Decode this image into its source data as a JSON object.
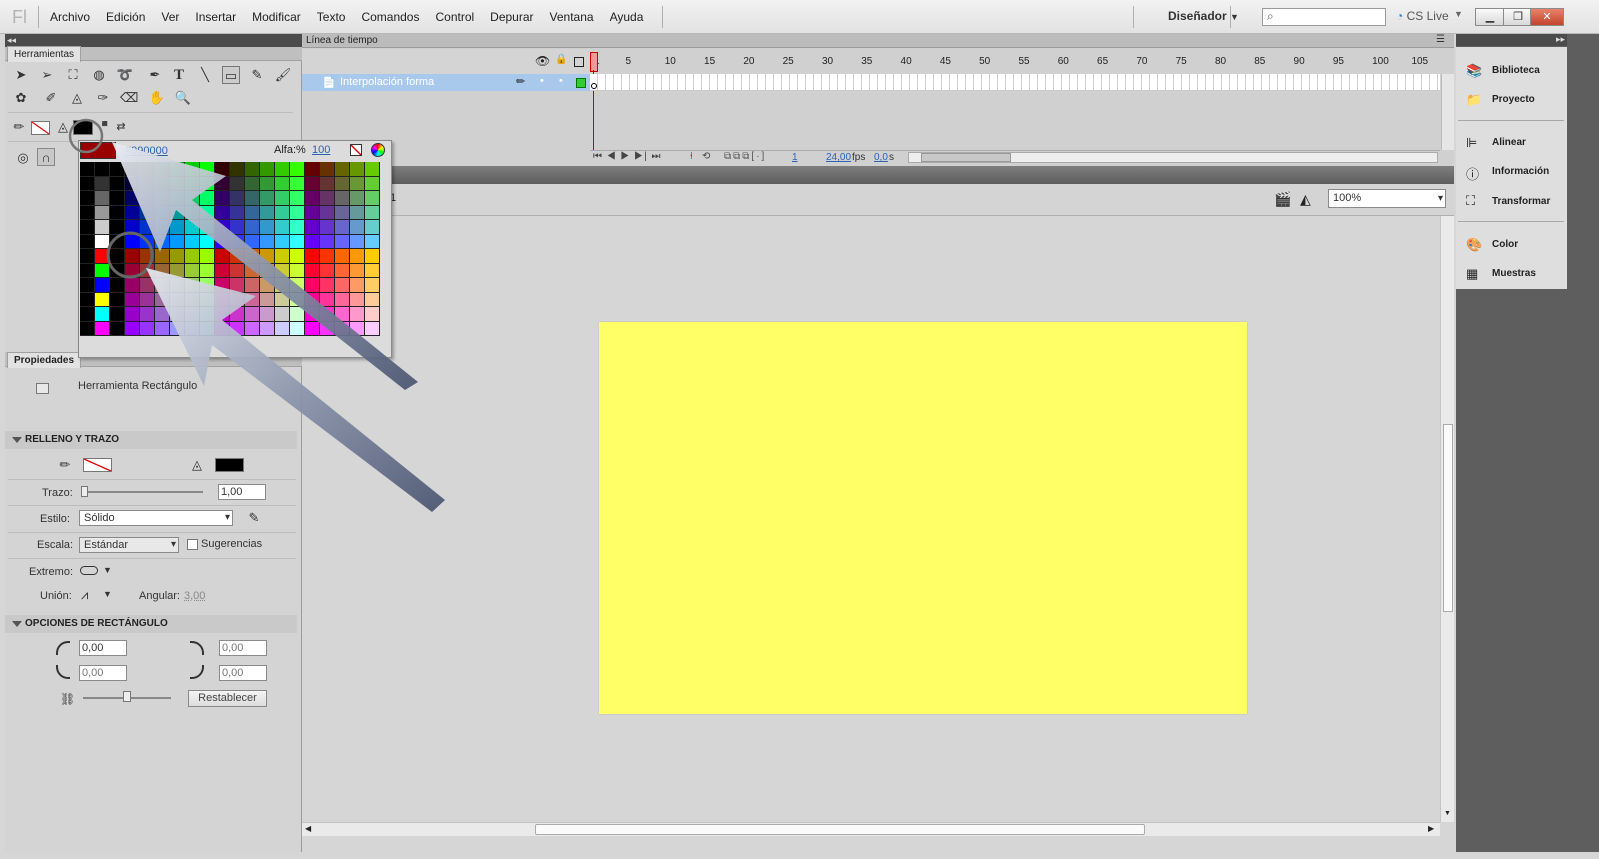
{
  "app": {
    "logo": "Fl",
    "menus": [
      "Archivo",
      "Edición",
      "Ver",
      "Insertar",
      "Modificar",
      "Texto",
      "Comandos",
      "Control",
      "Depurar",
      "Ventana",
      "Ayuda"
    ],
    "workspace": "Diseñador",
    "search_icon": "⌕",
    "cs_live": "CS Live"
  },
  "tools_panel": {
    "title": "Herramientas"
  },
  "color_popup": {
    "hex": "#990000",
    "alpha_label": "Alfa:%",
    "alpha_value": "100",
    "swatch_color": "#990000"
  },
  "properties": {
    "title": "Propiedades",
    "tool_name": "Herramienta Rectángulo",
    "fill_stroke": {
      "header": "RELLENO Y TRAZO",
      "trazo_label": "Trazo:",
      "trazo_value": "1,00",
      "estilo_label": "Estilo:",
      "estilo_value": "Sólido",
      "escala_label": "Escala:",
      "escala_value": "Estándar",
      "sugerencias_label": "Sugerencias",
      "extremo_label": "Extremo:",
      "union_label": "Unión:",
      "angular_label": "Angular:",
      "angular_value": "3,00"
    },
    "rect_options": {
      "header": "OPCIONES DE RECTÁNGULO",
      "r1": "0,00",
      "r2": "0,00",
      "r3": "0,00",
      "r4": "0,00",
      "reset_label": "Restablecer"
    }
  },
  "timeline": {
    "title": "Línea de tiempo",
    "layer_name": "Interpolación forma",
    "ruler": [
      "1",
      "5",
      "10",
      "15",
      "20",
      "25",
      "30",
      "35",
      "40",
      "45",
      "50",
      "55",
      "60",
      "65",
      "70",
      "75",
      "80",
      "85",
      "90",
      "95",
      "100",
      "105"
    ],
    "frame": "1",
    "fps": "24,00",
    "fps_unit": "fps",
    "time": "0,0",
    "time_unit": "s"
  },
  "stage": {
    "zoom": "100%",
    "scene_fragment": "1",
    "stage_color": "#ffff66"
  },
  "right_panel": {
    "items": [
      "Biblioteca",
      "Proyecto",
      "Alinear",
      "Información",
      "Transformar",
      "Color",
      "Muestras"
    ]
  }
}
